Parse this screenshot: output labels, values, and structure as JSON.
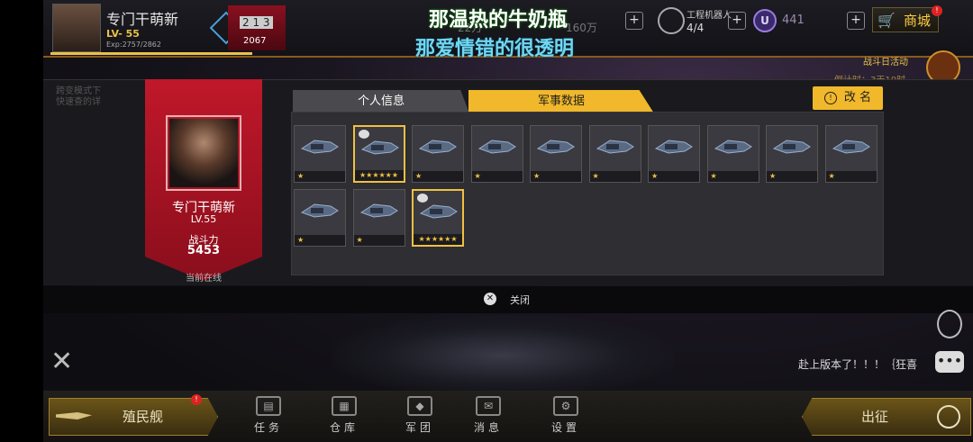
{
  "hud": {
    "player_name": "专门干萌新",
    "level": "LV- 55",
    "exp": "Exp:2757/2862",
    "rank_digits": "2 1 3",
    "rank_value": "2067",
    "resource1": "22万",
    "resource2": "160万",
    "engineer_label": "工程机器人",
    "engineer_count": "4/4",
    "u_symbol": "U",
    "u_value": "441",
    "shop_label": "商城",
    "shop_badge": "!",
    "event_label": "战斗日活动",
    "event_timer": "倒计时：3天10时"
  },
  "lyrics": {
    "line1": "那温热的牛奶瓶",
    "line2": "那爱情错的很透明"
  },
  "background_left": {
    "line1": "跨变模式下",
    "line2": "快速查的详"
  },
  "profile_card": {
    "name": "专门干萌新",
    "level": "LV.55",
    "power_label": "战斗力",
    "power_value": "5453",
    "status": "当前在线"
  },
  "tabs": [
    {
      "label": "个人信息",
      "active": false
    },
    {
      "label": "军事数据",
      "active": true
    }
  ],
  "rename_button": {
    "icon": "!",
    "label": "改 名"
  },
  "ships": [
    {
      "stars": "★",
      "selected": false,
      "tagged": false
    },
    {
      "stars": "★★★★★★",
      "selected": true,
      "tagged": true
    },
    {
      "stars": "★",
      "selected": false,
      "tagged": false
    },
    {
      "stars": "★",
      "selected": false,
      "tagged": false
    },
    {
      "stars": "★",
      "selected": false,
      "tagged": false
    },
    {
      "stars": "★",
      "selected": false,
      "tagged": false
    },
    {
      "stars": "★",
      "selected": false,
      "tagged": false
    },
    {
      "stars": "★",
      "selected": false,
      "tagged": false
    },
    {
      "stars": "★",
      "selected": false,
      "tagged": false
    },
    {
      "stars": "★",
      "selected": false,
      "tagged": false
    },
    {
      "stars": "★",
      "selected": false,
      "tagged": false
    },
    {
      "stars": "★",
      "selected": false,
      "tagged": false
    },
    {
      "stars": "★★★★★★",
      "selected": true,
      "tagged": true
    }
  ],
  "close": {
    "icon": "✕",
    "label": "关闭"
  },
  "chat": {
    "message": "赴上版本了！！！｛狂喜"
  },
  "bottom": {
    "colony_label": "殖民舰",
    "colony_badge": "!",
    "go_label": "出征",
    "nav": [
      {
        "label": "任务",
        "icon": "task-icon"
      },
      {
        "label": "仓库",
        "icon": "warehouse-icon"
      },
      {
        "label": "军团",
        "icon": "legion-icon"
      },
      {
        "label": "消息",
        "icon": "message-icon"
      },
      {
        "label": "设置",
        "icon": "settings-icon"
      }
    ]
  },
  "colors": {
    "accent": "#f0b82a",
    "card_red": "#c0182a",
    "cyan_lyric": "#6fd8f0"
  }
}
